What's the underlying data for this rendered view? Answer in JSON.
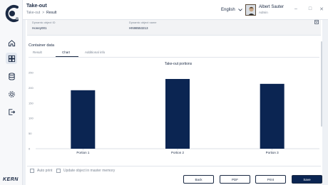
{
  "app": {
    "title": "Take-out",
    "brand": "KERN"
  },
  "breadcrumb": {
    "parent": "Take-out",
    "separator": ">",
    "current": "Result"
  },
  "header": {
    "language": "English",
    "user_name": "Albert Sauter",
    "user_role": "Admin"
  },
  "info": {
    "id_label": "Dynamic object ID",
    "id_value": "Honey001",
    "name_label": "Dynamic object name",
    "name_value": "HN98553213"
  },
  "container": {
    "title": "Container data",
    "tabs": [
      "Result",
      "Chart",
      "Additional info"
    ],
    "active_tab": "Chart"
  },
  "chart_data": {
    "type": "bar",
    "title": "Take-out portions",
    "categories": [
      "Portion 1",
      "Portion 2",
      "Portion 3"
    ],
    "values": [
      192,
      229,
      213
    ],
    "ylim": [
      0,
      250
    ],
    "yticks": [
      0,
      50,
      100,
      150,
      200,
      250
    ],
    "grid": false,
    "bar_color": "#0b2552"
  },
  "options": {
    "auto_print": "Auto print",
    "update_master": "Update object in master memory"
  },
  "buttons": {
    "back": "Back",
    "pdf": "PDF",
    "print": "Print",
    "save": "Save"
  },
  "colors": {
    "accent": "#0b2552",
    "text": "#1b2a44"
  }
}
